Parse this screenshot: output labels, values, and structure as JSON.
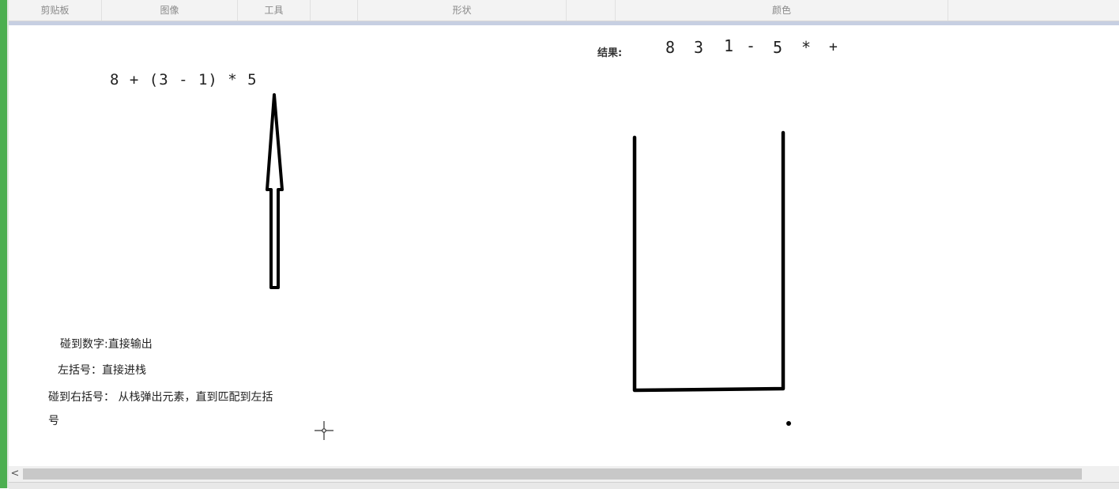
{
  "ribbon": {
    "groups": [
      {
        "label": "剪贴板"
      },
      {
        "label": "图像"
      },
      {
        "label": "工具"
      },
      {
        "label": ""
      },
      {
        "label": "形状"
      },
      {
        "label": ""
      },
      {
        "label": "颜色"
      }
    ]
  },
  "canvas": {
    "expression": "8 + (3 - 1) * 5",
    "result_label": "结果:",
    "result_tokens": [
      "8",
      "3",
      "1",
      "-",
      "5",
      "*",
      "+"
    ],
    "rules": {
      "rule1": "碰到数字:直接输出",
      "rule2": "左括号：直接进栈",
      "rule3_line1": "碰到右括号： 从栈弹出元素，直到匹配到左括",
      "rule3_line2": "号"
    }
  },
  "scrollbar": {
    "left_arrow": "<"
  },
  "colors": {
    "left_strip": "#4caf50",
    "ribbon_bg": "#f3f3f3",
    "accent_bar": "#c7cfe2"
  }
}
